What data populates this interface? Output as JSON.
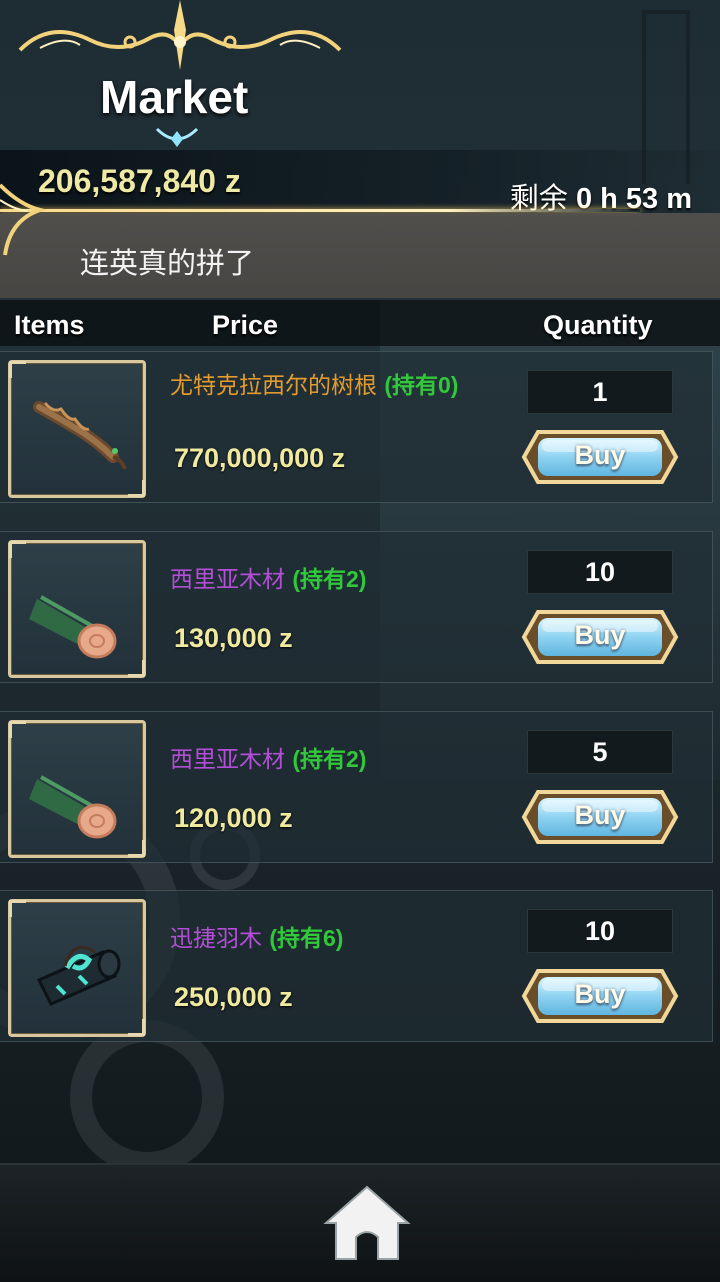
{
  "header": {
    "title": "Market",
    "money": "206,587,840 z",
    "time_label": "剩余",
    "time_value": "0 h 53 m",
    "message": "连英真的拼了"
  },
  "columns": {
    "items": "Items",
    "price": "Price",
    "quantity": "Quantity"
  },
  "items": [
    {
      "name": "尤特克拉西尔的树根",
      "name_color": "#e39a2e",
      "owned": "(持有0)",
      "price": "770,000,000 z",
      "quantity": "1",
      "buy_label": "Buy",
      "icon": "root-icon"
    },
    {
      "name": "西里亚木材",
      "name_color": "#b34fd6",
      "owned": "(持有2)",
      "price": "130,000 z",
      "quantity": "10",
      "buy_label": "Buy",
      "icon": "log-icon"
    },
    {
      "name": "西里亚木材",
      "name_color": "#b34fd6",
      "owned": "(持有2)",
      "price": "120,000 z",
      "quantity": "5",
      "buy_label": "Buy",
      "icon": "log-icon"
    },
    {
      "name": "迅捷羽木",
      "name_color": "#b34fd6",
      "owned": "(持有6)",
      "price": "250,000 z",
      "quantity": "10",
      "buy_label": "Buy",
      "icon": "featherwood-icon"
    }
  ],
  "footer": {
    "home_icon": "home-icon"
  }
}
